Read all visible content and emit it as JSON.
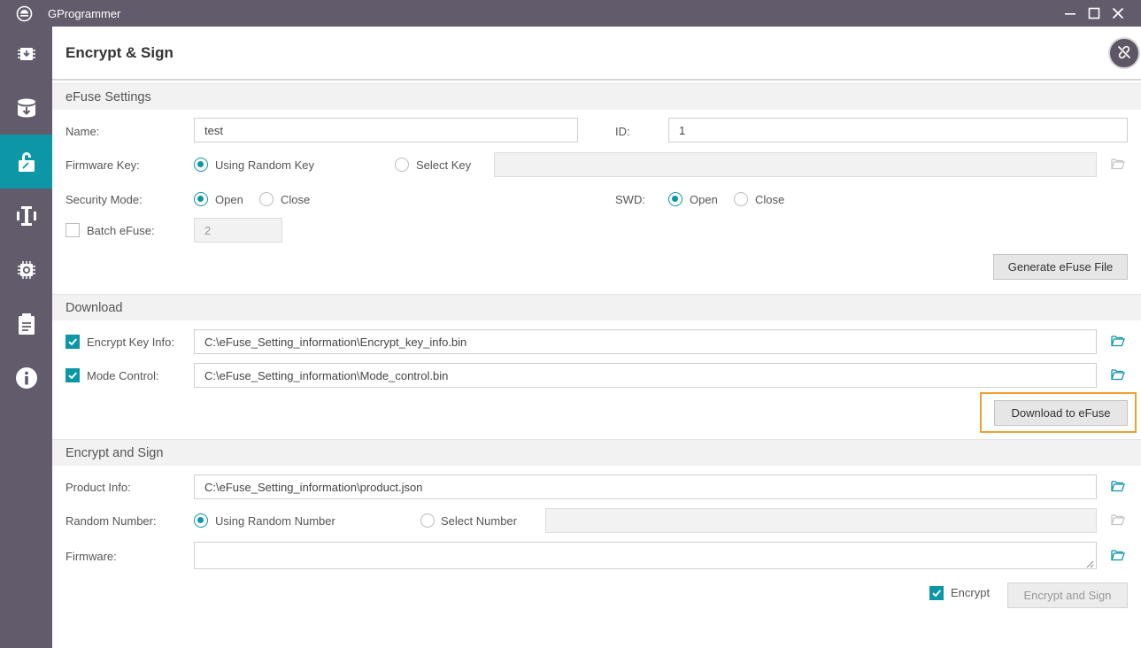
{
  "app": {
    "title": "GProgrammer"
  },
  "window_controls": [
    "minimize-icon",
    "maximize-icon",
    "close-icon"
  ],
  "sidebar": {
    "items": [
      {
        "icon": "chip-download-icon",
        "active": false
      },
      {
        "icon": "database-download-icon",
        "active": false
      },
      {
        "icon": "lock-icon",
        "active": true
      },
      {
        "icon": "io-icon",
        "active": false
      },
      {
        "icon": "chip-settings-icon",
        "active": false
      },
      {
        "icon": "clipboard-icon",
        "active": false
      },
      {
        "icon": "info-icon",
        "active": false
      }
    ]
  },
  "header": {
    "title": "Encrypt & Sign",
    "action_icon": "unlink-icon"
  },
  "efuse_settings": {
    "title": "eFuse Settings",
    "name_label": "Name:",
    "name_value": "test",
    "id_label": "ID:",
    "id_value": "1",
    "firmware_key_label": "Firmware Key:",
    "firmware_key_options": [
      "Using Random Key",
      "Select Key"
    ],
    "firmware_key_selected": "Using Random Key",
    "firmware_key_path": "",
    "security_mode_label": "Security Mode:",
    "security_mode_options": [
      "Open",
      "Close"
    ],
    "security_mode_selected": "Open",
    "swd_label": "SWD:",
    "swd_options": [
      "Open",
      "Close"
    ],
    "swd_selected": "Open",
    "batch_label": "Batch eFuse:",
    "batch_checked": false,
    "batch_value": "2",
    "generate_button": "Generate eFuse File"
  },
  "download": {
    "title": "Download",
    "encrypt_key_label": "Encrypt Key Info:",
    "encrypt_key_checked": true,
    "encrypt_key_path": "C:\\eFuse_Setting_information\\Encrypt_key_info.bin",
    "mode_control_label": "Mode Control:",
    "mode_control_checked": true,
    "mode_control_path": "C:\\eFuse_Setting_information\\Mode_control.bin",
    "download_button": "Download to eFuse"
  },
  "encrypt_sign": {
    "title": "Encrypt and Sign",
    "product_info_label": "Product Info:",
    "product_info_path": "C:\\eFuse_Setting_information\\product.json",
    "random_number_label": "Random Number:",
    "random_number_options": [
      "Using Random Number",
      "Select Number"
    ],
    "random_number_selected": "Using Random Number",
    "random_number_value": "",
    "firmware_label": "Firmware:",
    "firmware_path": "",
    "encrypt_label": "Encrypt",
    "encrypt_checked": true,
    "encrypt_sign_button": "Encrypt and Sign"
  },
  "colors": {
    "sidebar": "#625b6c",
    "accent": "#0d97a6",
    "highlight": "#f0a030"
  }
}
